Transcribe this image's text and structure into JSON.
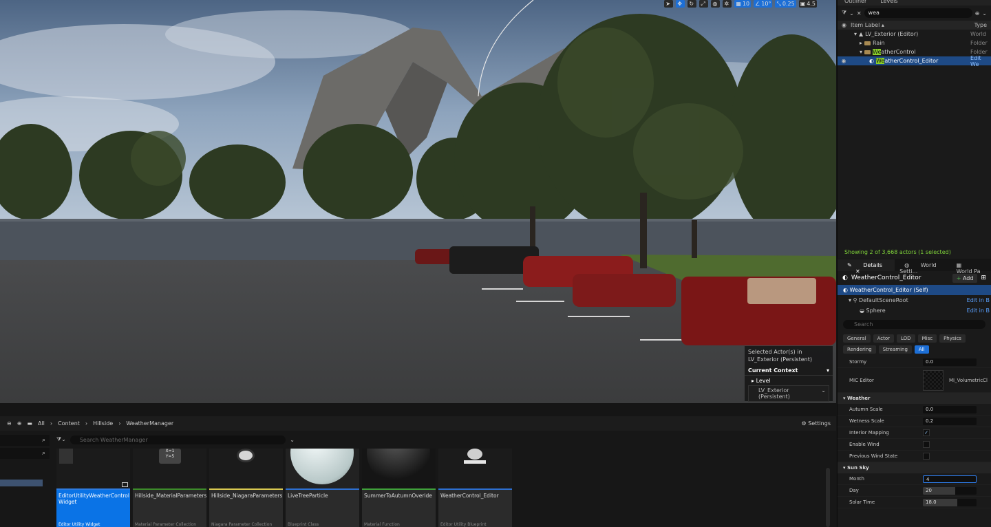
{
  "viewport": {
    "toolbar": {
      "grid_value": "10",
      "angle_value": "10°",
      "scale_value": "0.25",
      "camera_speed": "4.5"
    },
    "selection_overlay": {
      "line1": "Selected Actor(s) in",
      "line2": "LV_Exterior (Persistent)",
      "context_label": "Current Context",
      "level_label": "Level",
      "level_value": "LV_Exterior (Persistent)"
    }
  },
  "outliner": {
    "tabs": [
      "Outliner",
      "Levels"
    ],
    "search_value": "wea",
    "col_label": "Item Label",
    "col_type": "Type",
    "rows": [
      {
        "label": "LV_Exterior (Editor)",
        "type": "World"
      },
      {
        "label": "Rain",
        "type": "Folder"
      },
      {
        "label_hl": "We",
        "label_rest": "atherControl",
        "type": "Folder"
      },
      {
        "label_hl": "We",
        "label_rest": "atherControl_Editor",
        "type": "Edit We"
      }
    ],
    "status": "Showing 2 of 3,668 actors (1 selected)"
  },
  "details": {
    "tabs": [
      "Details",
      "World Setti...",
      "World Pa"
    ],
    "object_name": "WeatherControl_Editor",
    "add_label": "Add",
    "components": [
      {
        "label": "WeatherControl_Editor (Self)",
        "edit": ""
      },
      {
        "label": "DefaultSceneRoot",
        "edit": "Edit in B"
      },
      {
        "label": "Sphere",
        "edit": "Edit in B"
      }
    ],
    "search_placeholder": "Search",
    "filters": [
      "General",
      "Actor",
      "LOD",
      "Misc",
      "Physics",
      "Rendering",
      "Streaming",
      "All"
    ],
    "stormy_label": "Stormy",
    "stormy_value": "0.0",
    "mic_label": "MIC Editor",
    "mic_asset": "MI_VolumetricCl",
    "weather_cat": "Weather",
    "autumn_label": "Autumn Scale",
    "autumn_value": "0.0",
    "wetness_label": "Wetness Scale",
    "wetness_value": "0.2",
    "interior_label": "Interior Mapping",
    "wind_label": "Enable Wind",
    "prevwind_label": "Previous Wind State",
    "sunsky_cat": "Sun Sky",
    "month_label": "Month",
    "month_value": "4",
    "day_label": "Day",
    "day_value": "20",
    "solar_label": "Solar Time",
    "solar_value": "18.0"
  },
  "content_browser": {
    "breadcrumb": [
      "All",
      "Content",
      "Hillside",
      "WeatherManager"
    ],
    "settings_label": "Settings",
    "search_placeholder": "Search WeatherManager",
    "assets": [
      {
        "name": "EditorUtilityWeatherControl Widget",
        "type": "Editor Utility Widget",
        "color": "#2d7be0"
      },
      {
        "name": "Hillside_MaterialParameters",
        "type": "Material Parameter Collection",
        "color": "#3c8a2a"
      },
      {
        "name": "Hillside_NiagaraParameters",
        "type": "Niagara Parameter Collection",
        "color": "#d8c850"
      },
      {
        "name": "LiveTreeParticle",
        "type": "Blueprint Class",
        "color": "#2d6fd0"
      },
      {
        "name": "SummerToAutumnOveride",
        "type": "Material Function",
        "color": "#3fa03a"
      },
      {
        "name": "WeatherControl_Editor",
        "type": "Editor Utility Blueprint",
        "color": "#2d6fd0"
      }
    ],
    "tile_icon_text": "X=1\nY=5"
  }
}
